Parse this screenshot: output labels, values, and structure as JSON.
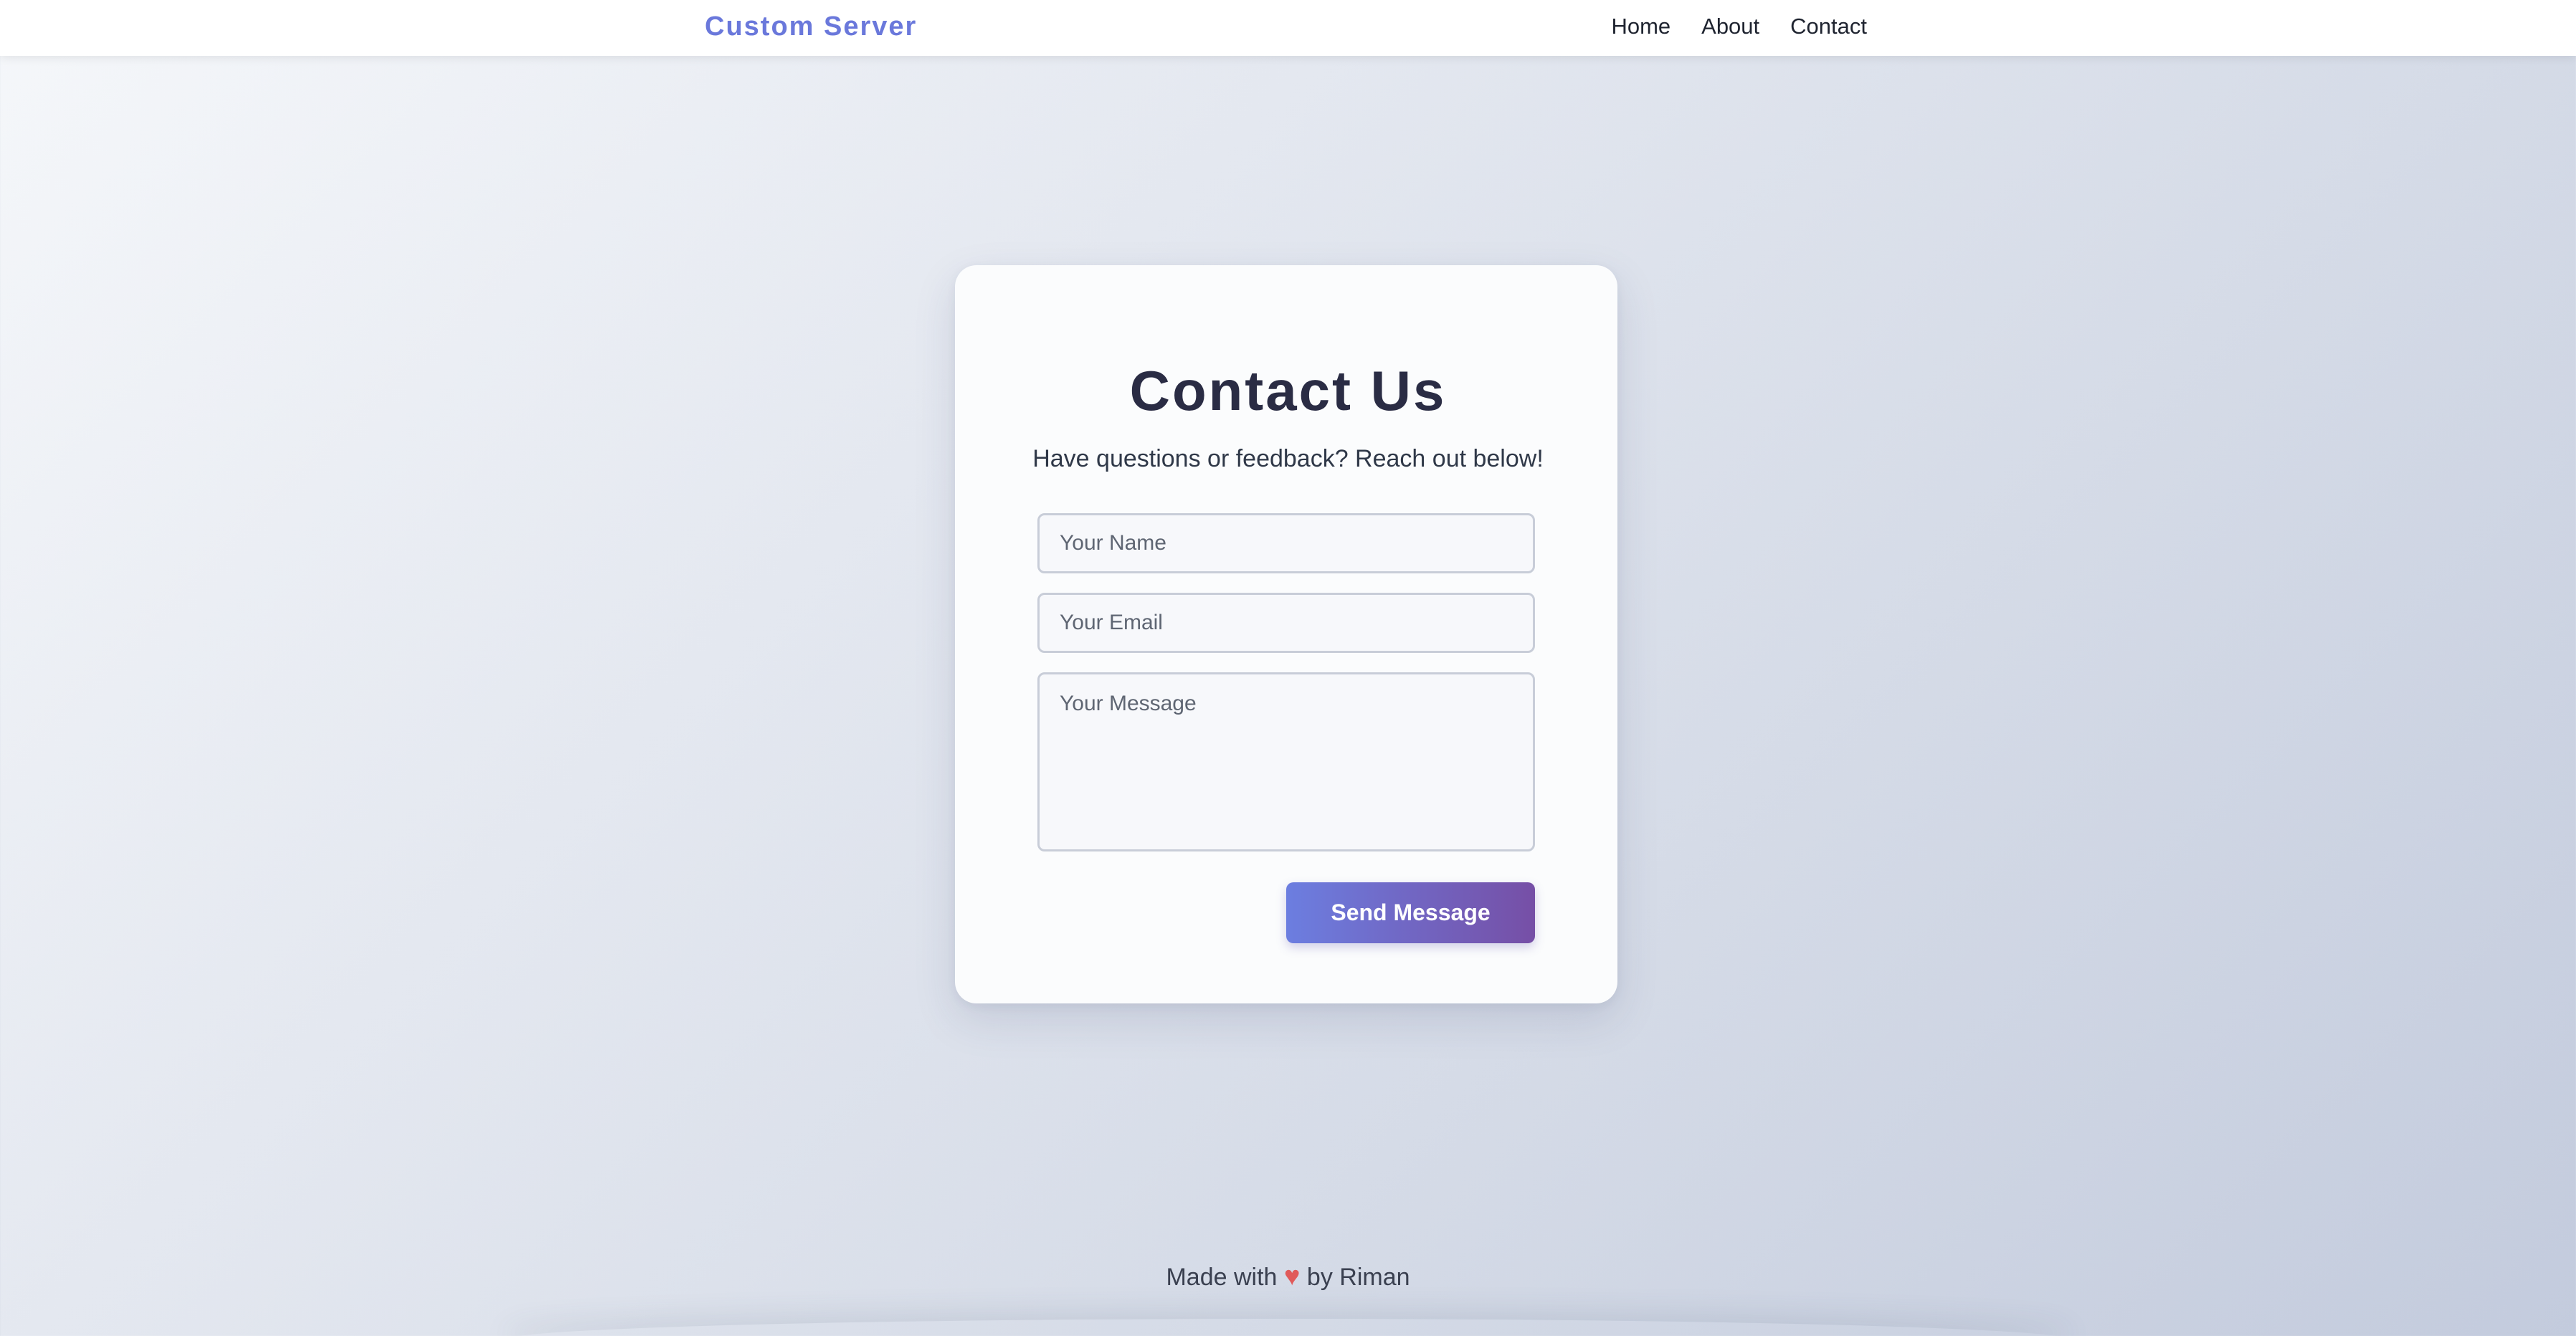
{
  "nav": {
    "brand": "Custom Server",
    "links": [
      "Home",
      "About",
      "Contact"
    ]
  },
  "contact": {
    "title": "Contact Us",
    "subtitle": "Have questions or feedback? Reach out below!",
    "name_placeholder": "Your Name",
    "email_placeholder": "Your Email",
    "message_placeholder": "Your Message",
    "submit_label": "Send Message"
  },
  "footer": {
    "prefix": "Made with",
    "heart": "♥",
    "suffix": "by Riman",
    "heart_color": "#e05a5a"
  },
  "theme": {
    "accent": "#6a78db",
    "button_gradient_start": "#6c7ee0",
    "button_gradient_end": "#764fa6"
  }
}
